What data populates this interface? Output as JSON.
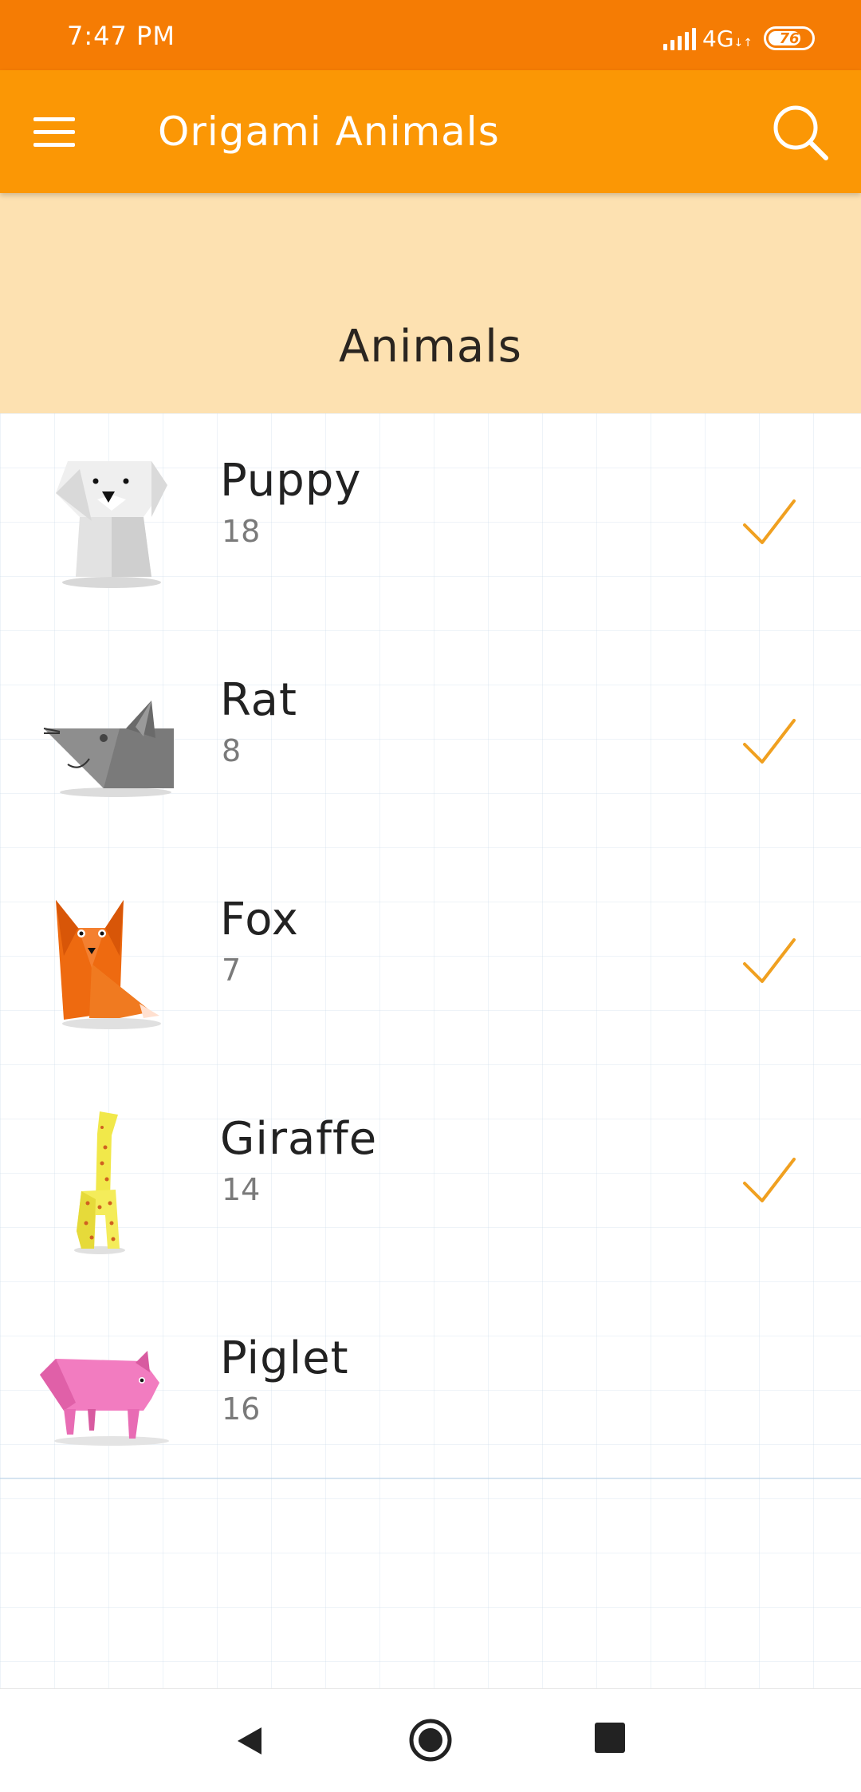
{
  "status_bar": {
    "time": "7:47 PM",
    "network": "4G",
    "battery": "76",
    "battery_level": 0.76
  },
  "app_bar": {
    "title": "Origami Animals",
    "menu_icon": "hamburger-menu-icon",
    "search_icon": "search-icon"
  },
  "section": {
    "title": "Animals"
  },
  "animals": [
    {
      "name": "Puppy",
      "count": "18",
      "completed": true
    },
    {
      "name": "Rat",
      "count": "8",
      "completed": true
    },
    {
      "name": "Fox",
      "count": "7",
      "completed": true
    },
    {
      "name": "Giraffe",
      "count": "14",
      "completed": true
    },
    {
      "name": "Piglet",
      "count": "16",
      "completed": false
    }
  ],
  "colors": {
    "status_bar": "#f57c04",
    "app_bar": "#fb9705",
    "header_band": "#fde1b1",
    "check": "#f0a020"
  },
  "nav": {
    "back_icon": "back-triangle-icon",
    "home_icon": "home-circle-icon",
    "recents_icon": "recents-square-icon"
  }
}
